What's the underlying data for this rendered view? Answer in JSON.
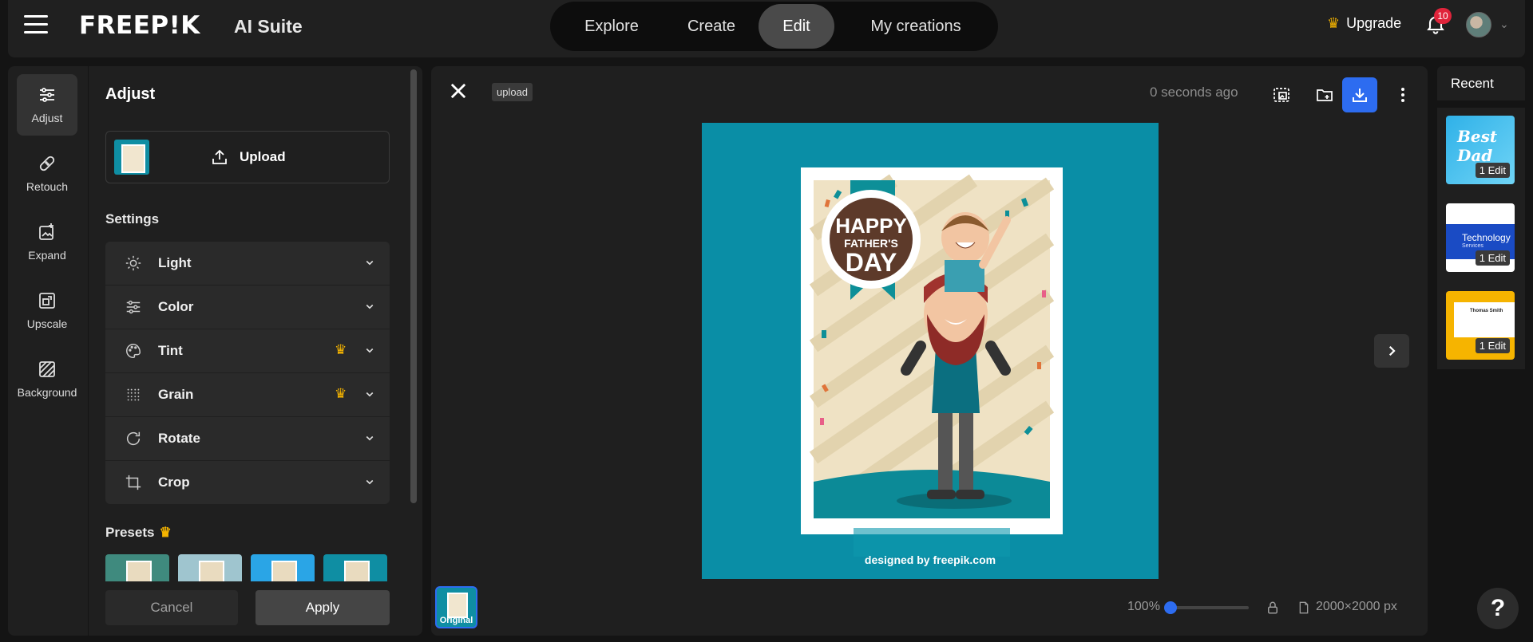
{
  "header": {
    "logo": "FREEP!K",
    "logo_sub": "AI Suite",
    "nav": [
      {
        "label": "Explore"
      },
      {
        "label": "Create"
      },
      {
        "label": "Edit"
      },
      {
        "label": "My creations"
      }
    ],
    "upgrade_label": "Upgrade",
    "notification_count": "10"
  },
  "rail": {
    "items": [
      {
        "label": "Adjust",
        "icon": "sliders-icon"
      },
      {
        "label": "Retouch",
        "icon": "bandage-icon"
      },
      {
        "label": "Expand",
        "icon": "expand-icon"
      },
      {
        "label": "Upscale",
        "icon": "upscale-icon"
      },
      {
        "label": "Background",
        "icon": "background-icon"
      }
    ]
  },
  "panel": {
    "title": "Adjust",
    "upload_label": "Upload",
    "settings_title": "Settings",
    "settings": [
      {
        "label": "Light",
        "icon": "sun-icon",
        "premium": false
      },
      {
        "label": "Color",
        "icon": "sliders-icon",
        "premium": false
      },
      {
        "label": "Tint",
        "icon": "palette-icon",
        "premium": true
      },
      {
        "label": "Grain",
        "icon": "grain-icon",
        "premium": true
      },
      {
        "label": "Rotate",
        "icon": "rotate-icon",
        "premium": false
      },
      {
        "label": "Crop",
        "icon": "crop-icon",
        "premium": false
      }
    ],
    "presets_title": "Presets",
    "cancel_label": "Cancel",
    "apply_label": "Apply"
  },
  "canvas": {
    "source_tag": "upload",
    "saved_time": "0 seconds ago",
    "image": {
      "card_line1": "HAPPY",
      "card_line2": "FATHER'S",
      "card_line3": "DAY",
      "credit": "designed by  freepik.com"
    },
    "original_label": "Original",
    "zoom": "100%",
    "dimensions": "2000×2000 px"
  },
  "recent": {
    "title": "Recent",
    "items": [
      {
        "badge": "1 Edit",
        "thumb_text": "Best Dad"
      },
      {
        "badge": "1 Edit",
        "thumb_text": "Technology",
        "thumb_sub": "Services"
      },
      {
        "badge": "1 Edit",
        "thumb_text": "Thomas Smith"
      }
    ]
  },
  "help_label": "?",
  "colors": {
    "accent": "#2d6cf0",
    "premium": "#f5b400",
    "image_bg": "#0a8ea6"
  }
}
